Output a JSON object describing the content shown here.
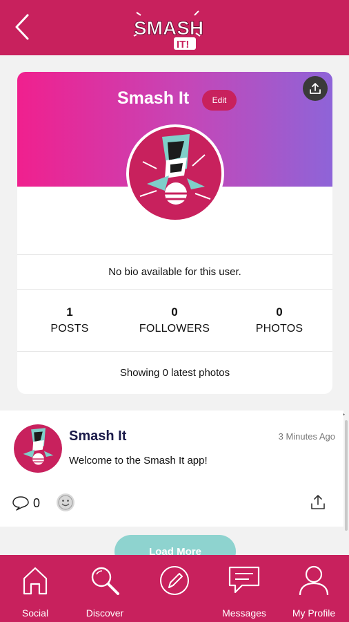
{
  "header": {
    "logo": "SMASH IT!"
  },
  "profile": {
    "name": "Smash It",
    "edit_label": "Edit",
    "bio": "No bio available for this user.",
    "stats": [
      {
        "value": "1",
        "label": "POSTS"
      },
      {
        "value": "0",
        "label": "FOLLOWERS"
      },
      {
        "value": "0",
        "label": "PHOTOS"
      }
    ],
    "latest_photos": "Showing 0 latest photos"
  },
  "post": {
    "author": "Smash It",
    "time": "3 Minutes Ago",
    "text": "Welcome to the Smash It app!",
    "comment_count": "0"
  },
  "load_more_label": "Load More",
  "nav": [
    {
      "label": "Social",
      "icon": "home-icon"
    },
    {
      "label": "Discover",
      "icon": "search-icon"
    },
    {
      "label": "",
      "icon": "pencil-icon"
    },
    {
      "label": "Messages",
      "icon": "chat-icon"
    },
    {
      "label": "My Profile",
      "icon": "user-icon"
    }
  ],
  "colors": {
    "brand": "#c8215d",
    "banner_start": "#f0208e",
    "banner_end": "#8e64d8",
    "load_more": "#8ed3cf"
  }
}
